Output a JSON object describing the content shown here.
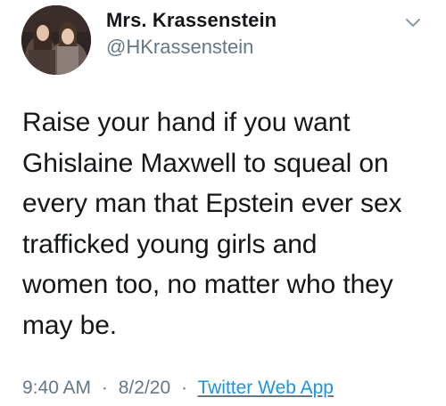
{
  "tweet": {
    "author_name": "Mrs. Krassenstein",
    "author_handle": "@HKrassenstein",
    "body": "Raise your hand if you want\nGhislaine Maxwell to squeal on\nevery man that Epstein ever sex\ntrafficked young girls and\nwomen too, no matter who they\nmay be.",
    "time": "9:40 AM",
    "separator_1": "·",
    "date": "8/2/20",
    "separator_2": "·",
    "source": "Twitter Web App"
  },
  "icons": {
    "menu": "chevron-down-icon",
    "avatar": "avatar"
  },
  "colors": {
    "primary_text": "#14171a",
    "secondary_text": "#657786",
    "link": "#1b95e0"
  }
}
